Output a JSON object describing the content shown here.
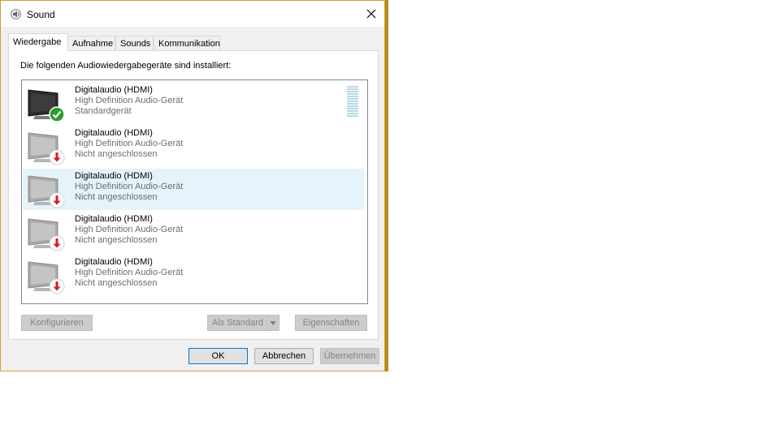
{
  "window": {
    "title": "Sound"
  },
  "tabs": [
    {
      "label": "Wiedergabe",
      "active": true
    },
    {
      "label": "Aufnahme",
      "active": false
    },
    {
      "label": "Sounds",
      "active": false
    },
    {
      "label": "Kommunikation",
      "active": false
    }
  ],
  "panel": {
    "label": "Die folgenden Audiowiedergabegeräte sind installiert:"
  },
  "devices": [
    {
      "name": "Digitalaudio (HDMI)",
      "driver": "High Definition Audio-Gerät",
      "status": "Standardgerät",
      "state": "default",
      "selected": false
    },
    {
      "name": "Digitalaudio (HDMI)",
      "driver": "High Definition Audio-Gerät",
      "status": "Nicht angeschlossen",
      "state": "disconnected",
      "selected": false
    },
    {
      "name": "Digitalaudio (HDMI)",
      "driver": "High Definition Audio-Gerät",
      "status": "Nicht angeschlossen",
      "state": "disconnected",
      "selected": true
    },
    {
      "name": "Digitalaudio (HDMI)",
      "driver": "High Definition Audio-Gerät",
      "status": "Nicht angeschlossen",
      "state": "disconnected",
      "selected": false
    },
    {
      "name": "Digitalaudio (HDMI)",
      "driver": "High Definition Audio-Gerät",
      "status": "Nicht angeschlossen",
      "state": "disconnected",
      "selected": false
    }
  ],
  "buttons": {
    "configure": "Konfigurieren",
    "set_default": "Als Standard",
    "properties": "Eigenschaften",
    "ok": "OK",
    "cancel": "Abbrechen",
    "apply": "Übernehmen"
  },
  "icons": {
    "app": "speaker-icon",
    "close": "close-icon",
    "default_badge": "check-icon",
    "disconnected_badge": "down-arrow-icon",
    "dropdown": "chevron-down-icon"
  },
  "colors": {
    "selection": "#e5f3fb",
    "default_badge": "#2a9d2a",
    "disconnected_badge": "#d21f1f",
    "focus_border": "#0078d7"
  }
}
